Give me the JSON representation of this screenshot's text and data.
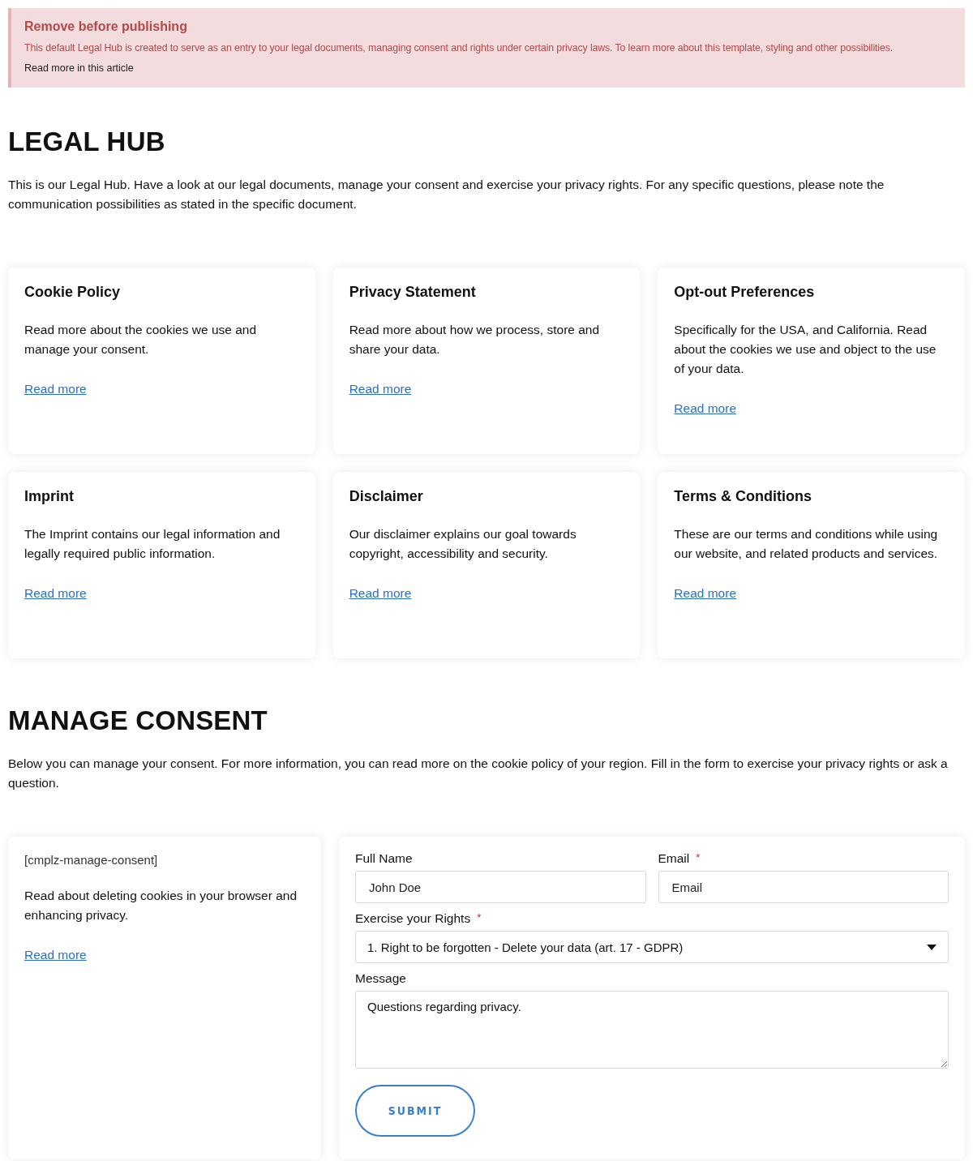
{
  "notice": {
    "title": "Remove before publishing",
    "text": "This default Legal Hub is created to serve as an entry to your legal documents, managing consent and rights under certain privacy laws. To learn more about this template, styling and other possibilities.",
    "link": "Read more in this article"
  },
  "legal_hub": {
    "heading": "LEGAL HUB",
    "intro": "This is our Legal Hub. Have a look at our legal documents, manage your consent and exercise your privacy rights. For any specific questions, please note the communication possibilities as stated in the specific document.",
    "cards": [
      {
        "title": "Cookie Policy",
        "text": "Read more about the cookies we use and manage your consent.",
        "link": "Read more"
      },
      {
        "title": "Privacy Statement",
        "text": "Read more about how we process, store and share your data.",
        "link": "Read more"
      },
      {
        "title": "Opt-out Preferences",
        "text": "Specifically for the USA, and California. Read about the cookies we use and object to the use of your data.",
        "link": "Read more"
      },
      {
        "title": "Imprint",
        "text": "The Imprint contains our legal information and legally required public information.",
        "link": "Read more"
      },
      {
        "title": "Disclaimer",
        "text": "Our disclaimer explains our goal towards copyright, accessibility and security.",
        "link": "Read more"
      },
      {
        "title": "Terms & Conditions",
        "text": "These are our terms and conditions while using our website, and related products and services.",
        "link": "Read more"
      }
    ]
  },
  "manage_consent": {
    "heading": "MANAGE CONSENT",
    "intro": "Below you can manage your consent. For more information, you can read more on the cookie policy of your region. Fill in the form to exercise your privacy rights or ask a question.",
    "side_card": {
      "shortcode": "[cmplz-manage-consent]",
      "text": "Read about deleting cookies in your browser and enhancing privacy.",
      "link": "Read more"
    },
    "form": {
      "full_name": {
        "label": "Full Name",
        "placeholder": "John Doe"
      },
      "email": {
        "label": "Email",
        "required_mark": "*",
        "placeholder": "Email"
      },
      "rights": {
        "label": "Exercise your Rights",
        "required_mark": "*",
        "value": "1. Right to be forgotten - Delete your data (art. 17 - GDPR)"
      },
      "message": {
        "label": "Message",
        "value": "Questions regarding privacy."
      },
      "submit": "SUBMIT"
    }
  }
}
